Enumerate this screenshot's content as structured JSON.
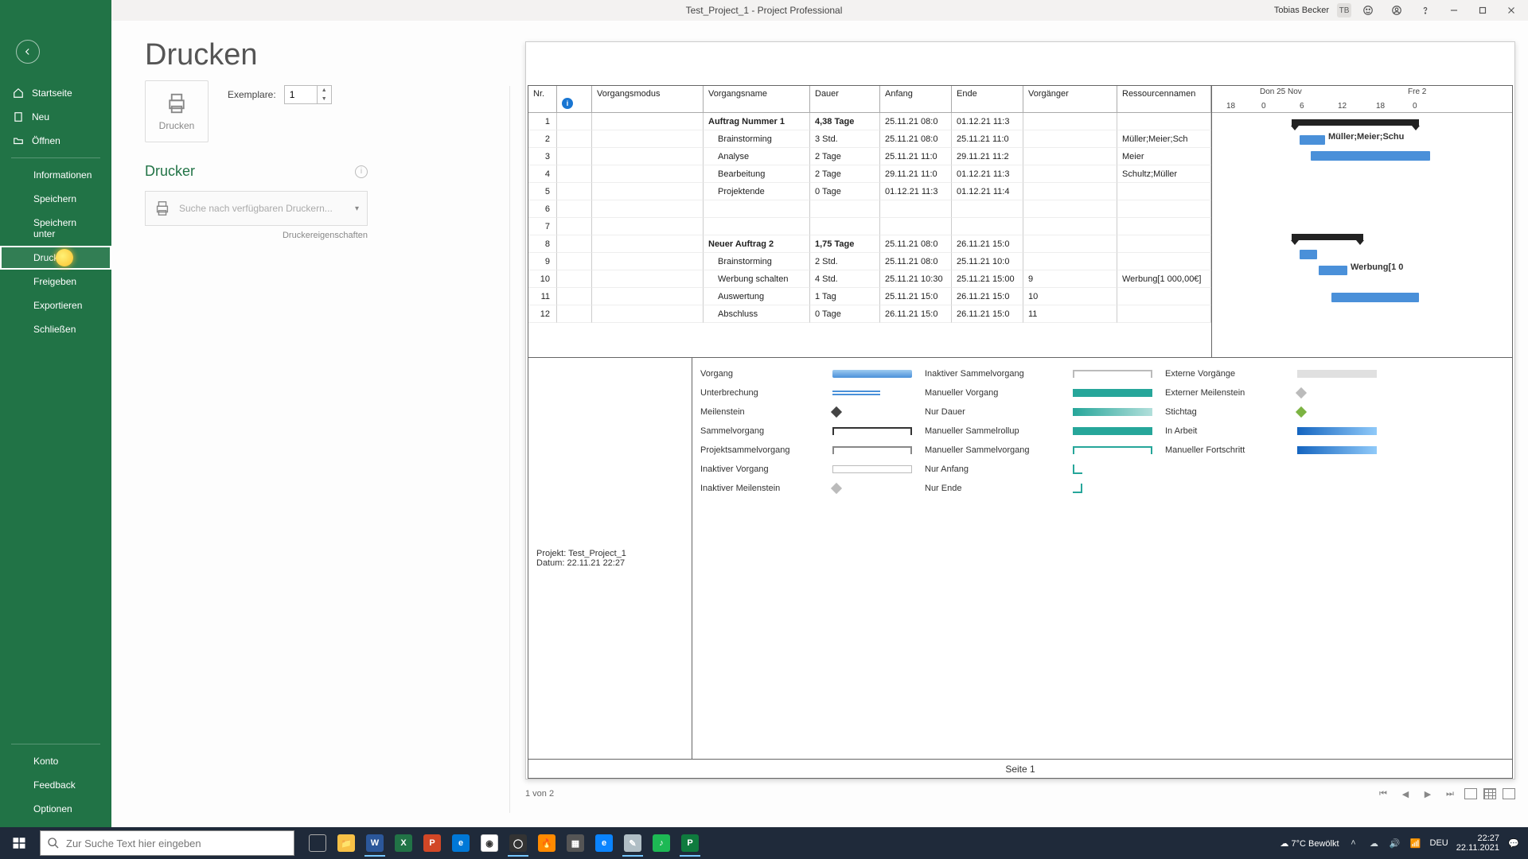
{
  "titlebar": {
    "title": "Test_Project_1  -  Project Professional",
    "user": "Tobias Becker",
    "initials": "TB"
  },
  "sidebar": {
    "startseite": "Startseite",
    "neu": "Neu",
    "oeffnen": "Öffnen",
    "informationen": "Informationen",
    "speichern": "Speichern",
    "speichern_unter": "Speichern unter",
    "drucken": "Drucken",
    "freigeben": "Freigeben",
    "exportieren": "Exportieren",
    "schliessen": "Schließen",
    "konto": "Konto",
    "feedback": "Feedback",
    "optionen": "Optionen"
  },
  "print": {
    "heading": "Drucken",
    "button": "Drucken",
    "copies_label": "Exemplare:",
    "copies_value": "1",
    "printer_heading": "Drucker",
    "printer_placeholder": "Suche nach verfügbaren Druckern...",
    "printer_properties": "Druckereigenschaften"
  },
  "preview": {
    "columns": {
      "nr": "Nr.",
      "info": "",
      "modus": "Vorgangsmodus",
      "name": "Vorgangsname",
      "dauer": "Dauer",
      "anfang": "Anfang",
      "ende": "Ende",
      "vorgaenger": "Vorgänger",
      "ress": "Ressourcennamen"
    },
    "rows": [
      {
        "nr": "1",
        "info": "",
        "name": "Auftrag Nummer 1",
        "dauer": "4,38 Tage",
        "anfang": "25.11.21 08:0",
        "ende": "01.12.21 11:3",
        "vor": "",
        "ress": "",
        "bold": true
      },
      {
        "nr": "2",
        "info": "✓",
        "name": "Brainstorming",
        "dauer": "3 Std.",
        "anfang": "25.11.21 08:0",
        "ende": "25.11.21 11:0",
        "vor": "",
        "ress": "Müller;Meier;Sch"
      },
      {
        "nr": "3",
        "info": "",
        "name": "Analyse",
        "dauer": "2 Tage",
        "anfang": "25.11.21 11:0",
        "ende": "29.11.21 11:2",
        "vor": "",
        "ress": "Meier"
      },
      {
        "nr": "4",
        "info": "",
        "name": "Bearbeitung",
        "dauer": "2 Tage",
        "anfang": "29.11.21 11:0",
        "ende": "01.12.21 11:3",
        "vor": "",
        "ress": "Schultz;Müller"
      },
      {
        "nr": "5",
        "info": "",
        "name": "Projektende",
        "dauer": "0 Tage",
        "anfang": "01.12.21 11:3",
        "ende": "01.12.21 11:4",
        "vor": "",
        "ress": ""
      },
      {
        "nr": "6",
        "info": "",
        "name": "",
        "dauer": "",
        "anfang": "",
        "ende": "",
        "vor": "",
        "ress": ""
      },
      {
        "nr": "7",
        "info": "",
        "name": "",
        "dauer": "",
        "anfang": "",
        "ende": "",
        "vor": "",
        "ress": ""
      },
      {
        "nr": "8",
        "info": "",
        "name": "Neuer Auftrag 2",
        "dauer": "1,75 Tage",
        "anfang": "25.11.21 08:0",
        "ende": "26.11.21 15:0",
        "vor": "",
        "ress": "",
        "bold": true
      },
      {
        "nr": "9",
        "info": "",
        "name": "Brainstorming",
        "dauer": "2 Std.",
        "anfang": "25.11.21 08:0",
        "ende": "25.11.21 10:0",
        "vor": "",
        "ress": ""
      },
      {
        "nr": "10",
        "info": "",
        "name": "Werbung schalten",
        "dauer": "4 Std.",
        "anfang": "25.11.21 10:30",
        "ende": "25.11.21 15:00",
        "vor": "9",
        "ress": "Werbung[1 000,00€]"
      },
      {
        "nr": "11",
        "info": "",
        "name": "Auswertung",
        "dauer": "1 Tag",
        "anfang": "25.11.21 15:0",
        "ende": "26.11.21 15:0",
        "vor": "10",
        "ress": ""
      },
      {
        "nr": "12",
        "info": "",
        "name": "Abschluss",
        "dauer": "0 Tage",
        "anfang": "26.11.21 15:0",
        "ende": "26.11.21 15:0",
        "vor": "11",
        "ress": ""
      }
    ],
    "gantt": {
      "day_label": "Don 25 Nov",
      "day_label2": "Fre 2",
      "ticks": [
        "18",
        "0",
        "6",
        "12",
        "18",
        "0"
      ],
      "label1": "Müller;Meier;Schu",
      "label2": "Werbung[1 0"
    },
    "meta": {
      "line1": "Projekt: Test_Project_1",
      "line2": "Datum: 22.11.21 22:27"
    },
    "legend": {
      "vorgang": "Vorgang",
      "unterbrechung": "Unterbrechung",
      "meilenstein": "Meilenstein",
      "sammelvorgang": "Sammelvorgang",
      "projektsammel": "Projektsammelvorgang",
      "inaktiv_vorgang": "Inaktiver Vorgang",
      "inaktiv_meilenstein": "Inaktiver Meilenstein",
      "inaktiv_sammel": "Inaktiver Sammelvorgang",
      "manuell_vorgang": "Manueller Vorgang",
      "nur_dauer": "Nur Dauer",
      "manuell_rollup": "Manueller Sammelrollup",
      "manuell_sammel": "Manueller Sammelvorgang",
      "nur_anfang": "Nur Anfang",
      "nur_ende": "Nur Ende",
      "externe_vorgaenge": "Externe Vorgänge",
      "externer_meilenstein": "Externer Meilenstein",
      "stichtag": "Stichtag",
      "in_arbeit": "In Arbeit",
      "manuell_fortschritt": "Manueller Fortschritt"
    },
    "page_label": "Seite 1",
    "page_counter": "1 von 2"
  },
  "taskbar": {
    "search_placeholder": "Zur Suche Text hier eingeben",
    "weather": "7°C  Bewölkt",
    "lang": "DEU",
    "time": "22:27",
    "date": "22.11.2021"
  }
}
